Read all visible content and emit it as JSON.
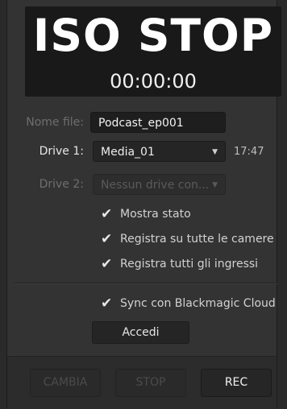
{
  "display": {
    "status": "ISO STOP",
    "timer": "00:00:00"
  },
  "form": {
    "filename": {
      "label": "Nome file:",
      "value": "Podcast_ep001"
    },
    "drive1": {
      "label": "Drive 1:",
      "value": "Media_01",
      "remaining": "17:47"
    },
    "drive2": {
      "label": "Drive 2:",
      "value": "Nessun drive con..."
    }
  },
  "options": [
    {
      "label": "Mostra stato",
      "checked": true
    },
    {
      "label": "Registra su tutte le camere",
      "checked": true
    },
    {
      "label": "Registra tutti gli ingressi",
      "checked": true
    }
  ],
  "cloud": {
    "sync_label": "Sync con Blackmagic Cloud",
    "sync_checked": true,
    "login_label": "Accedi"
  },
  "actions": {
    "change_label": "CAMBIA",
    "stop_label": "STOP",
    "rec_label": "REC"
  },
  "icons": {
    "checkmark": "check-icon",
    "dropdown": "chevron-down-icon"
  }
}
